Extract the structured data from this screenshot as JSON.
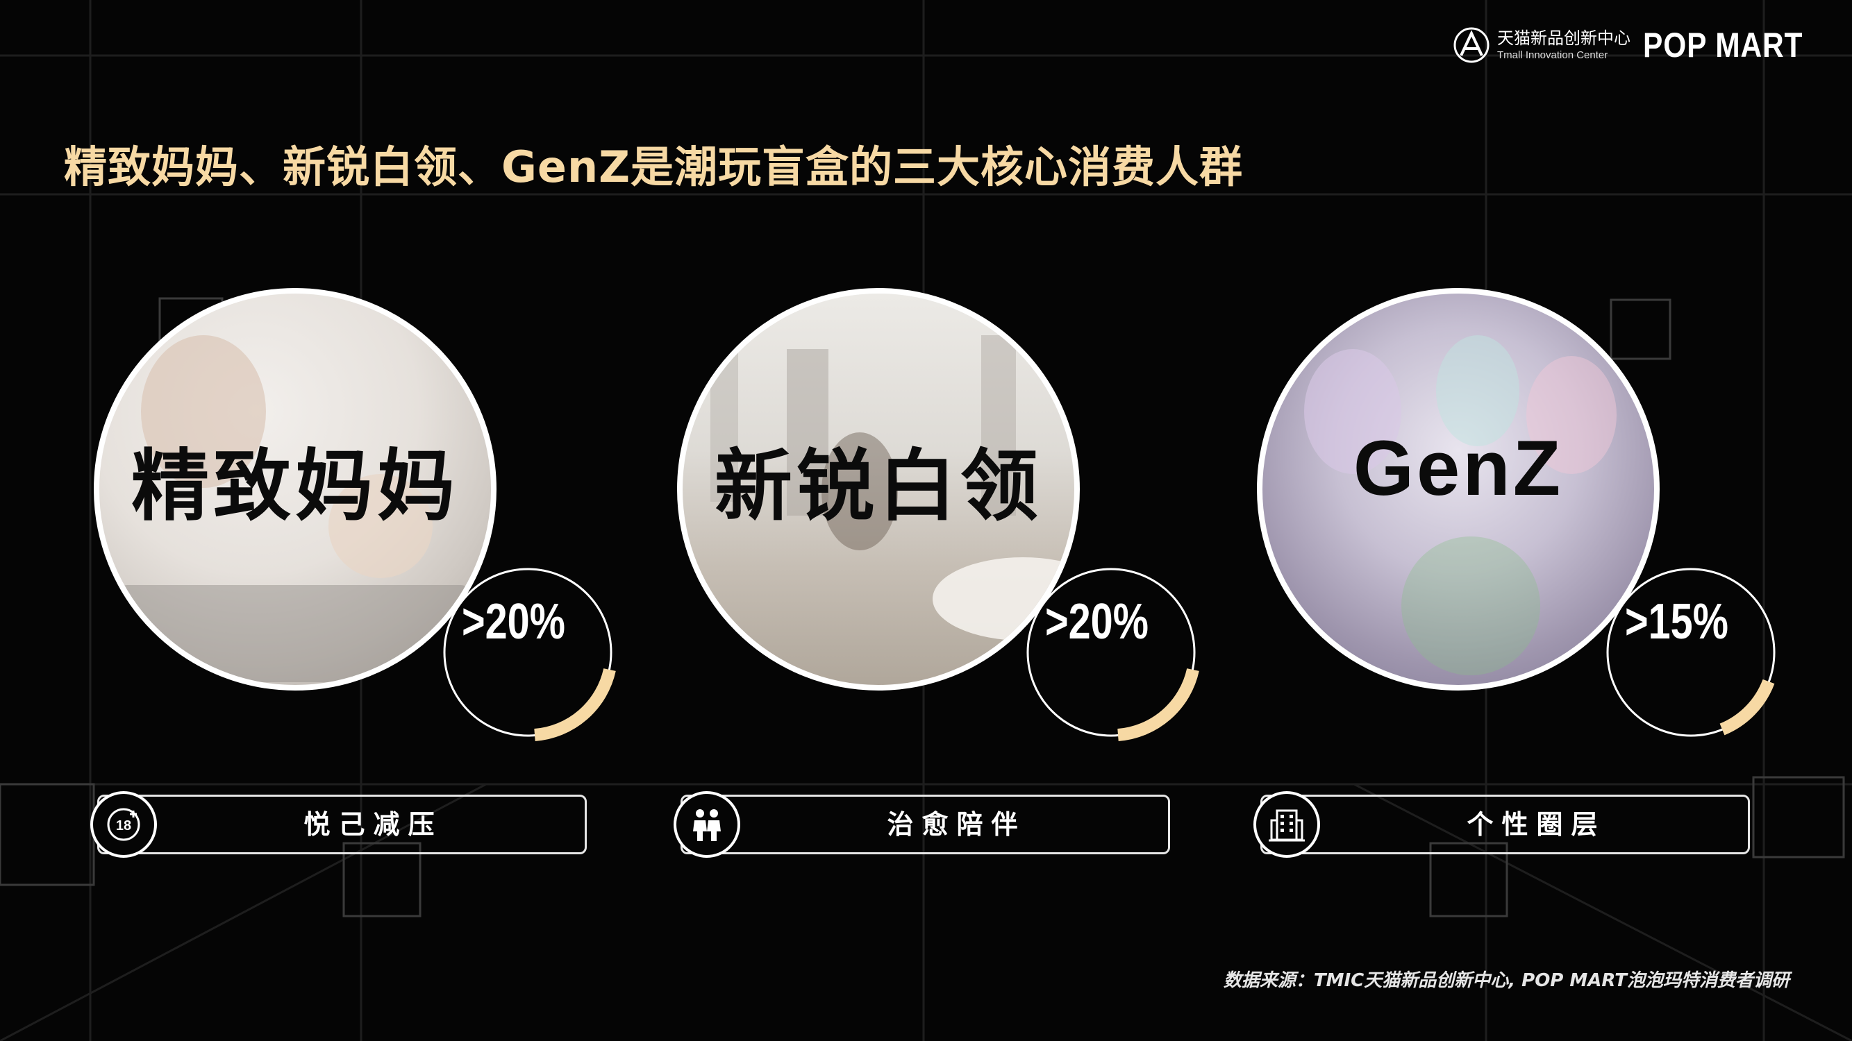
{
  "header": {
    "tmic_name_cn": "天猫新品创新中心",
    "tmic_name_en": "Tmall Innovation Center",
    "brand_logo": "POP MART"
  },
  "headline": "精致妈妈、新锐白领、GenZ是潮玩盲盒的三大核心消费人群",
  "segments": [
    {
      "title": "精致妈妈",
      "percent_label": ">20%",
      "percent_value": 20,
      "tag": "悦己减压",
      "icon": "age-18-plus-icon"
    },
    {
      "title": "新锐白领",
      "percent_label": ">20%",
      "percent_value": 20,
      "tag": "治愈陪伴",
      "icon": "people-pair-icon"
    },
    {
      "title": "GenZ",
      "percent_label": ">15%",
      "percent_value": 15,
      "tag": "个性圈层",
      "icon": "building-icon"
    }
  ],
  "source": "数据来源：TMIC天猫新品创新中心, POP MART泡泡玛特消费者调研",
  "colors": {
    "accent": "#f7d9a4",
    "background": "#050505",
    "text": "#ffffff"
  }
}
